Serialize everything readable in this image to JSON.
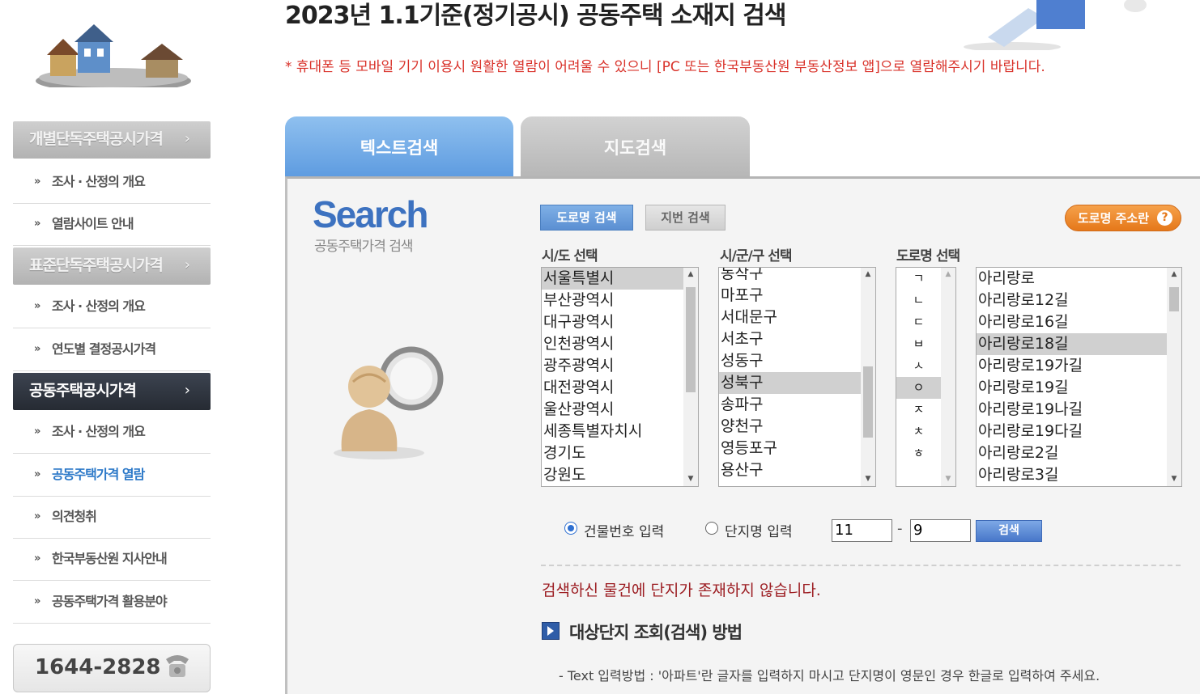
{
  "header": {
    "title": "2023년 1.1기준(정기공시) 공동주택 소재지 검색",
    "notice": "* 휴대폰 등 모바일 기기 이용시 원활한 열람이 어려울 수 있으니 [PC 또는 한국부동산원 부동산정보 앱]으로 열람해주시기 바랍니다."
  },
  "sidebar": {
    "menu1": {
      "label": "개별단독주택공시가격",
      "chev": "›",
      "items": [
        "조사 · 산정의 개요",
        "열람사이트 안내"
      ]
    },
    "menu2": {
      "label": "표준단독주택공시가격",
      "chev": "›",
      "items": [
        "조사 · 산정의 개요",
        "연도별 결정공시가격"
      ]
    },
    "menu3": {
      "label": "공동주택공시가격",
      "chev": "›",
      "items": [
        "조사 · 산정의 개요",
        "공동주택가격 열람",
        "의견청취",
        "한국부동산원 지사안내",
        "공동주택가격 활용분야"
      ]
    },
    "phone": "1644-2828"
  },
  "tabs": {
    "text_search": "텍스트검색",
    "map_search": "지도검색"
  },
  "search_logo": {
    "title": "Search",
    "subtitle": "공동주택가격 검색"
  },
  "buttons": {
    "road_search": "도로명 검색",
    "lot_search": "지번 검색",
    "road_help": "도로명 주소란",
    "help_mark": "?",
    "search": "검색"
  },
  "columns": {
    "sido": "시/도 선택",
    "sigungu": "시/군/구 선택",
    "road": "도로명 선택"
  },
  "sido_list": [
    "서울특별시",
    "부산광역시",
    "대구광역시",
    "인천광역시",
    "광주광역시",
    "대전광역시",
    "울산광역시",
    "세종특별자치시",
    "경기도",
    "강원도"
  ],
  "sigungu_list": [
    "동작구",
    "마포구",
    "서대문구",
    "서초구",
    "성동구",
    "성북구",
    "송파구",
    "양천구",
    "영등포구",
    "용산구"
  ],
  "jamo_list": [
    "ㄱ",
    "ㄴ",
    "ㄷ",
    "ㅂ",
    "ㅅ",
    "ㅇ",
    "ㅈ",
    "ㅊ",
    "ㅎ"
  ],
  "road_list": [
    "아리랑로",
    "아리랑로12길",
    "아리랑로16길",
    "아리랑로18길",
    "아리랑로19가길",
    "아리랑로19길",
    "아리랑로19나길",
    "아리랑로19다길",
    "아리랑로2길",
    "아리랑로3길"
  ],
  "selected": {
    "sido": "서울특별시",
    "sigungu": "성북구",
    "jamo": "ㅇ",
    "road": "아리랑로18길"
  },
  "input_mode": {
    "building_no": "건물번호 입력",
    "complex_name": "단지명 입력",
    "selected": "건물번호 입력"
  },
  "building_no": {
    "main": "11",
    "sub": "9",
    "separator": "-"
  },
  "result_message": "검색하신 물건에 단지가 존재하지 않습니다.",
  "howto_title": "대상단지 조회(검색) 방법",
  "howto_line": "- Text 입력방법 : '아파트'란 글자를 입력하지 마시고 단지명이 영문인 경우 한글로 입력하여 주세요."
}
